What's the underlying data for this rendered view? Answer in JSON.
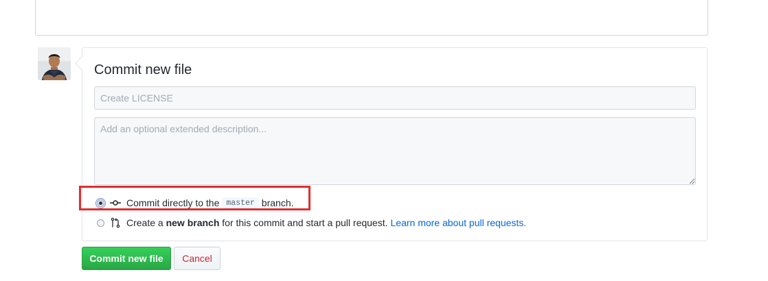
{
  "commit": {
    "title": "Commit new file",
    "summary_placeholder": "Create LICENSE",
    "description_placeholder": "Add an optional extended description...",
    "option_direct": {
      "prefix": "Commit directly to the",
      "branch": "master",
      "suffix": "branch.",
      "selected": true
    },
    "option_new_branch": {
      "prefix": "Create a",
      "bold": "new branch",
      "suffix": "for this commit and start a pull request.",
      "link": "Learn more about pull requests.",
      "selected": false
    }
  },
  "buttons": {
    "commit_label": "Commit new file",
    "cancel_label": "Cancel"
  },
  "icons": {
    "commit": "git-commit-icon",
    "pull_request": "git-pull-request-icon"
  },
  "colors": {
    "primary_button": "#28a745",
    "cancel_text": "#cb2431",
    "link": "#0366d6",
    "highlight_box": "#e02e2e"
  }
}
